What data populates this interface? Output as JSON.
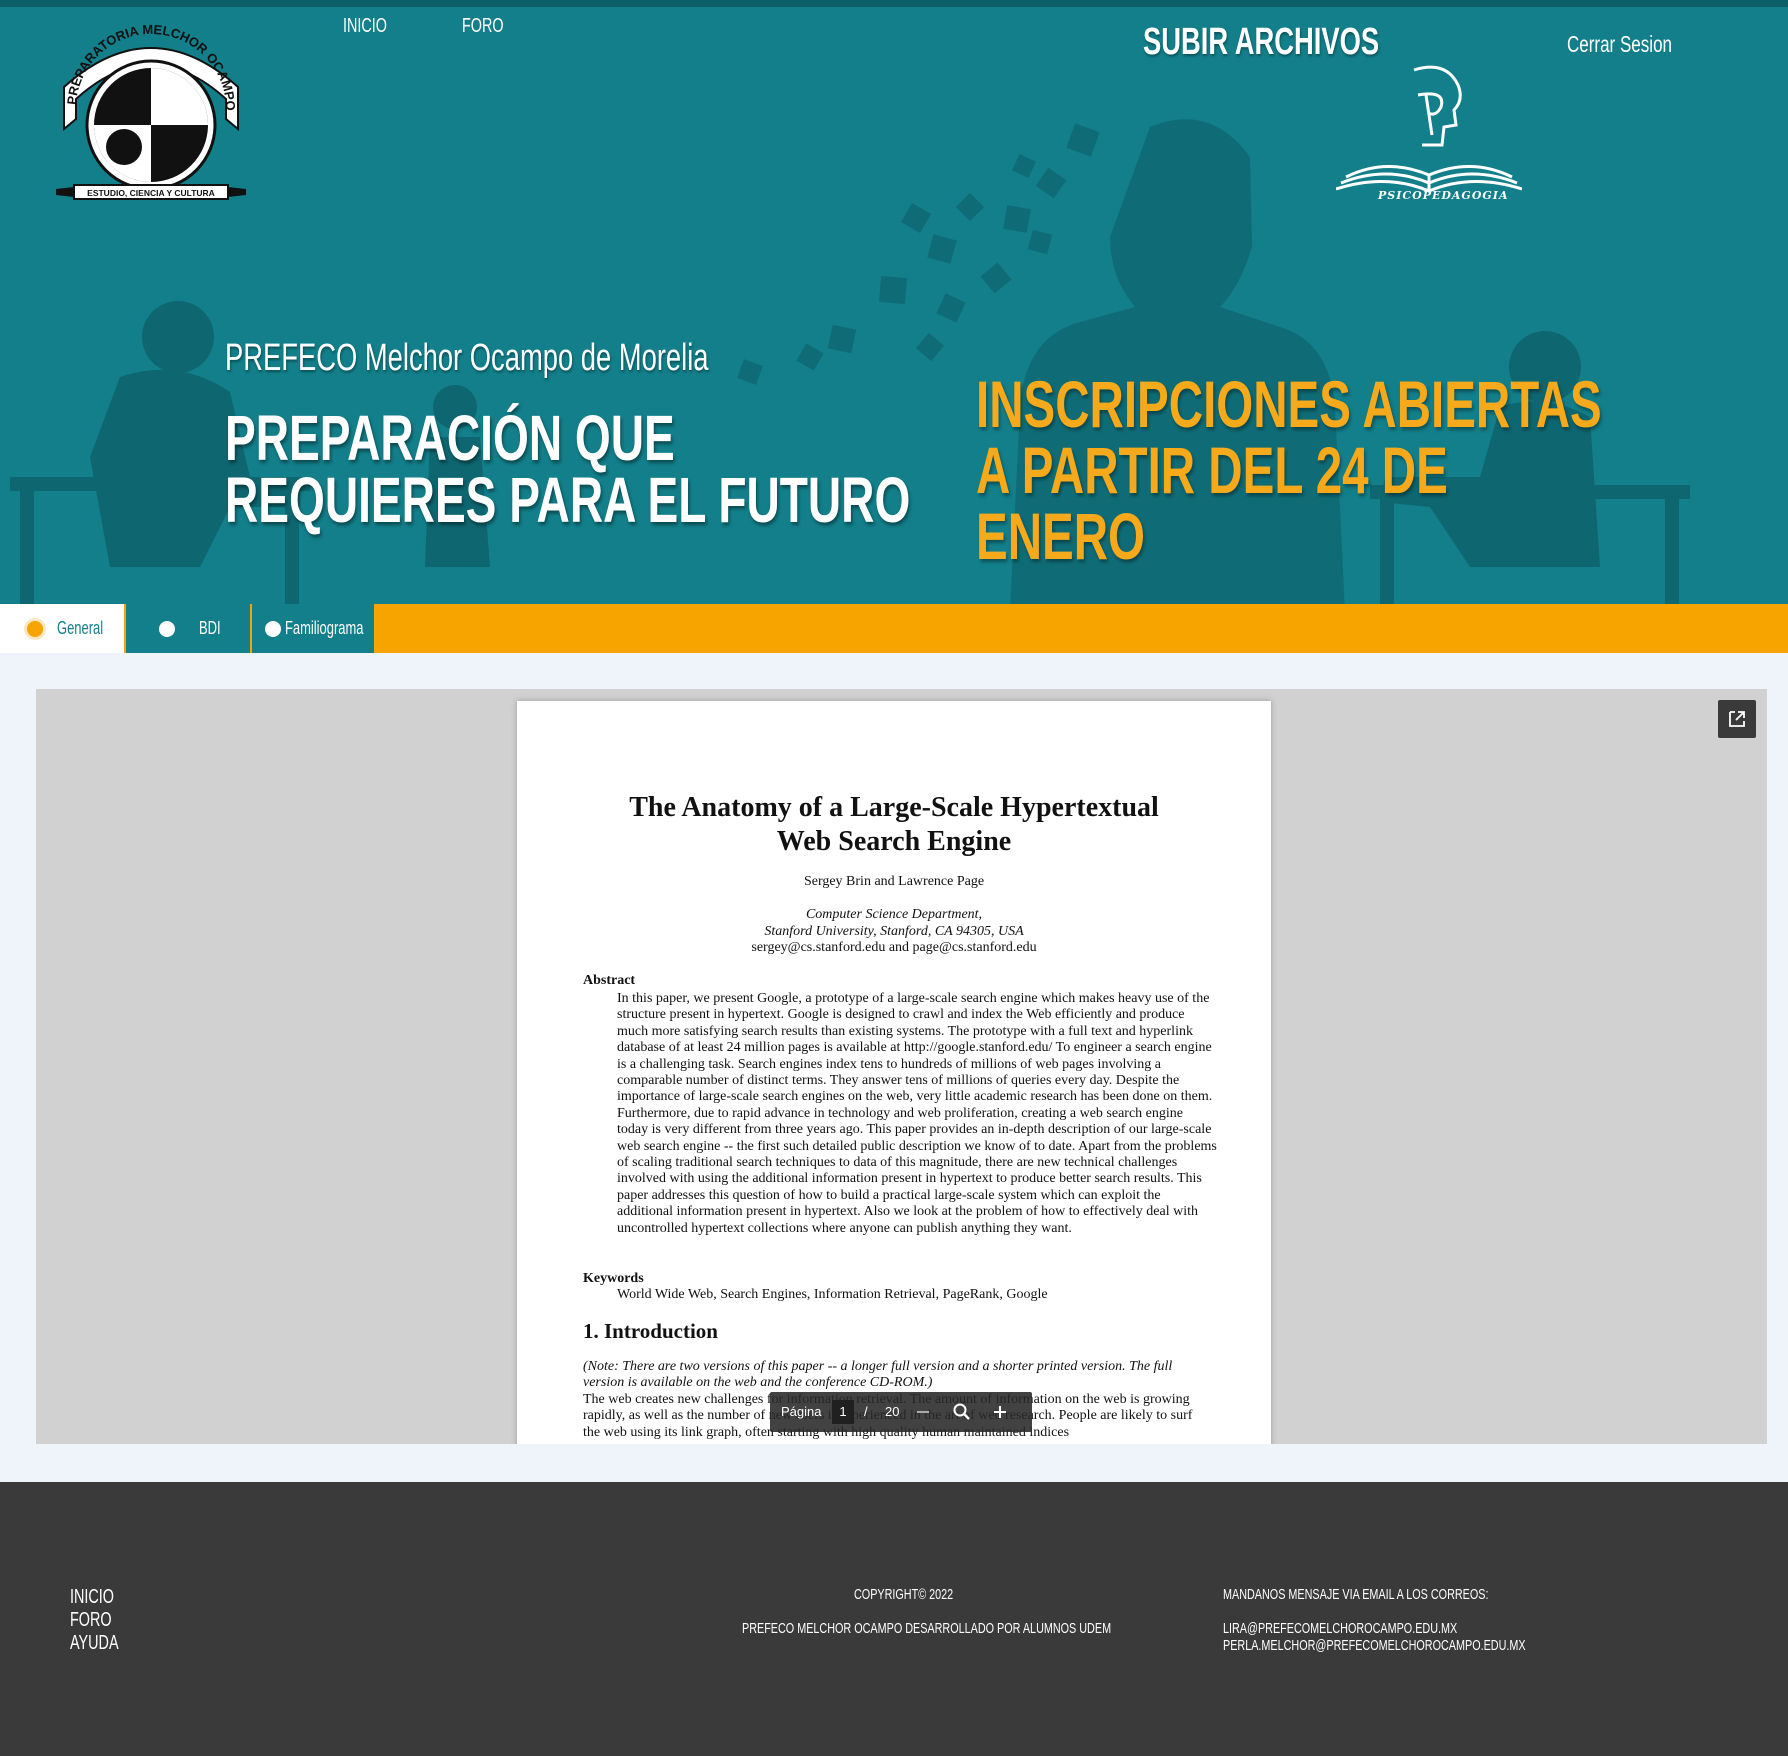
{
  "nav": {
    "inicio": "INICIO",
    "foro": "FORO",
    "upload": "SUBIR ARCHIVOS",
    "logout": "Cerrar Sesion"
  },
  "logos": {
    "school_arc_text": "PREPARATORIA MELCHOR OCAMPO",
    "school_ribbon_text": "ESTUDIO, CIENCIA Y CULTURA",
    "psico_caption": "PSICOPEDAGOGIA"
  },
  "hero": {
    "subtitle": "PREFECO Melchor Ocampo de Morelia",
    "title": "PREPARACIÓN QUE REQUIERES PARA EL FUTURO",
    "promo": "INSCRIPCIONES ABIERTAS A PARTIR DEL 24 DE ENERO"
  },
  "tabs": [
    {
      "label": "General",
      "active": true
    },
    {
      "label": "BDI",
      "active": false
    },
    {
      "label": "Familiograma",
      "active": false
    }
  ],
  "document": {
    "title_line1": "The Anatomy of a Large-Scale Hypertextual",
    "title_line2": "Web Search Engine",
    "authors": "Sergey Brin and Lawrence Page",
    "affiliation_line1": "Computer Science Department,",
    "affiliation_line2": "Stanford University, Stanford, CA 94305, USA",
    "emails": "sergey@cs.stanford.edu and page@cs.stanford.edu",
    "abstract_heading": "Abstract",
    "abstract_text": "In this paper, we present Google, a prototype of a large-scale search engine which makes heavy use of the structure present in hypertext. Google is designed to crawl and index the Web efficiently and produce much more satisfying search results than existing systems. The prototype with a full text and hyperlink database of at least 24 million pages is available at http://google.stanford.edu/ To engineer a search engine is a challenging task. Search engines index tens to hundreds of millions of web pages involving a comparable number of distinct terms. They answer tens of millions of queries every day. Despite the importance of large-scale search engines on the web, very little academic research has been done on them. Furthermore, due to rapid advance in technology and web proliferation, creating a web search engine today is very different from three years ago. This paper provides an in-depth description of our large-scale web search engine -- the first such detailed public description we know of to date. Apart from the problems of scaling traditional search techniques to data of this magnitude, there are new technical challenges involved with using the additional information present in hypertext to produce better search results. This paper addresses this question of how to build a practical large-scale system which can exploit the additional information present in hypertext. Also we look at the problem of how to effectively deal with uncontrolled hypertext collections where anyone can publish anything they want.",
    "keywords_heading": "Keywords",
    "keywords_text": "World Wide Web, Search Engines, Information Retrieval, PageRank, Google",
    "section_heading": "1. Introduction",
    "note_text": "(Note: There are two versions of this paper -- a longer full version and a shorter printed version. The full version is available on the web and the conference CD-ROM.)",
    "body_text": "The web creates new challenges for information retrieval. The amount of information on the web is growing rapidly, as well as the number of new users inexperienced in the art of web research. People are likely to surf the web using its link graph, often starting with high quality human maintained indices"
  },
  "pdf_toolbar": {
    "page_label": "Página",
    "current_page": "1",
    "separator": "/",
    "total_pages": "20"
  },
  "footer": {
    "links": [
      "INICIO",
      "FORO",
      "AYUDA"
    ],
    "copyright": "COPYRIGHT© 2022",
    "credit": "PREFECO MELCHOR OCAMPO DESARROLLADO POR ALUMNOS UDEM",
    "contact_heading": "MANDANOS MENSAJE VIA EMAIL A LOS CORREOS:",
    "email1": "LIRA@PREFECOMELCHOROCAMPO.EDU.MX",
    "email2": "PERLA.MELCHOR@PREFECOMELCHOROCAMPO.EDU.MX"
  },
  "colors": {
    "teal": "#127f8a",
    "orange": "#f8a400",
    "footer": "#3a3a3a"
  }
}
